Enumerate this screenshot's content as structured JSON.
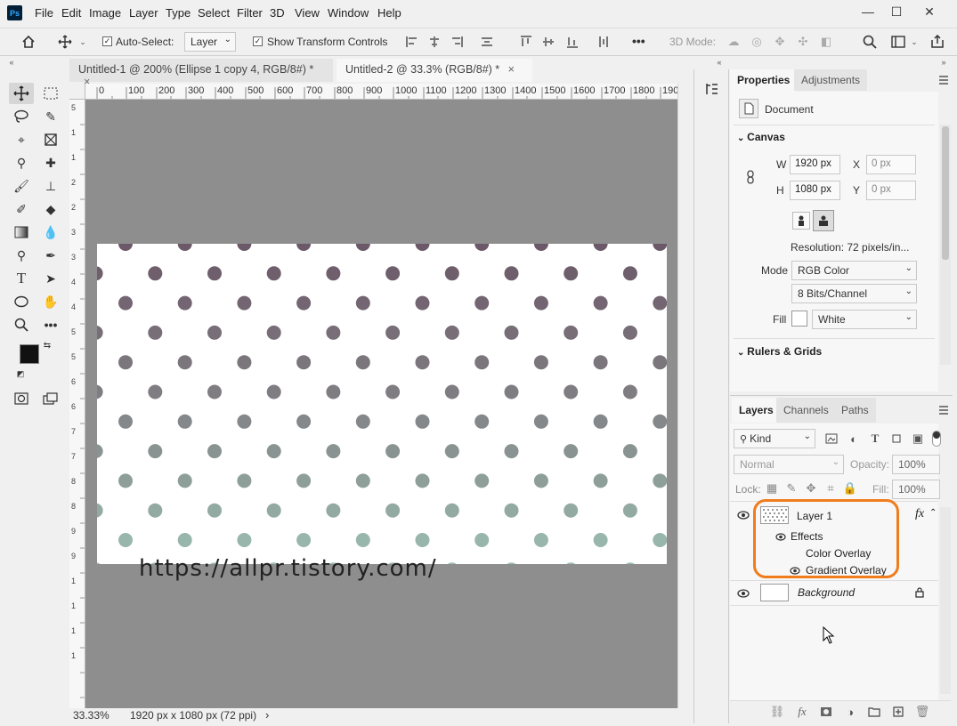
{
  "app": {
    "logo": "Ps"
  },
  "menu": [
    "File",
    "Edit",
    "Image",
    "Layer",
    "Type",
    "Select",
    "Filter",
    "3D",
    "View",
    "Window",
    "Help"
  ],
  "window_controls": {
    "minimize": "—",
    "maximize": "☐",
    "close": "✕"
  },
  "options_bar": {
    "auto_select_label": "Auto-Select:",
    "auto_select_value": "Layer",
    "show_transform_label": "Show Transform Controls",
    "mode3d_label": "3D Mode:",
    "more": "•••"
  },
  "tabs": [
    {
      "label": "Untitled-1 @ 200% (Ellipse 1 copy 4, RGB/8#) *",
      "close": "×"
    },
    {
      "label": "Untitled-2 @ 33.3% (RGB/8#) *",
      "close": "×"
    }
  ],
  "ruler_h": [
    "0",
    "100",
    "200",
    "300",
    "400",
    "500",
    "600",
    "700",
    "800",
    "900",
    "1000",
    "1100",
    "1200",
    "1300",
    "1400",
    "1500",
    "1600",
    "1700",
    "1800",
    "190"
  ],
  "ruler_v": [
    "5",
    "1",
    "1",
    "2",
    "2",
    "3",
    "3",
    "4",
    "4",
    "5",
    "5",
    "6",
    "6",
    "7",
    "7",
    "8",
    "8",
    "9",
    "9",
    "1",
    "1",
    "1",
    "1"
  ],
  "status": {
    "zoom": "33.33%",
    "doc_info": "1920 px x 1080 px (72 ppi)",
    "arrow": "›"
  },
  "watermark": "https://allpr.tistory.com/",
  "pattern": {
    "color_top": "#6b5868",
    "color_mid": "#7e7b80",
    "color_bottom": "#9cbfb2"
  },
  "properties": {
    "tab_properties": "Properties",
    "tab_adjustments": "Adjustments",
    "doc_label": "Document",
    "canvas_title": "Canvas",
    "w_label": "W",
    "w_value": "1920 px",
    "h_label": "H",
    "h_value": "1080 px",
    "x_label": "X",
    "x_value": "0 px",
    "y_label": "Y",
    "y_value": "0 px",
    "resolution": "Resolution: 72 pixels/in...",
    "mode_label": "Mode",
    "mode_value": "RGB Color",
    "bits_value": "8 Bits/Channel",
    "fill_label": "Fill",
    "fill_value": "White",
    "rulers_title": "Rulers & Grids"
  },
  "layers_panel": {
    "tab_layers": "Layers",
    "tab_channels": "Channels",
    "tab_paths": "Paths",
    "kind": "Kind",
    "blend": "Normal",
    "opacity_label": "Opacity:",
    "opacity_value": "100%",
    "lock_label": "Lock:",
    "fill_label": "Fill:",
    "fill_value": "100%",
    "layer1": "Layer 1",
    "fx": "fx",
    "effects": "Effects",
    "color_overlay": "Color Overlay",
    "gradient_overlay": "Gradient Overlay",
    "background": "Background",
    "highlight_color": "#f07c1c"
  }
}
